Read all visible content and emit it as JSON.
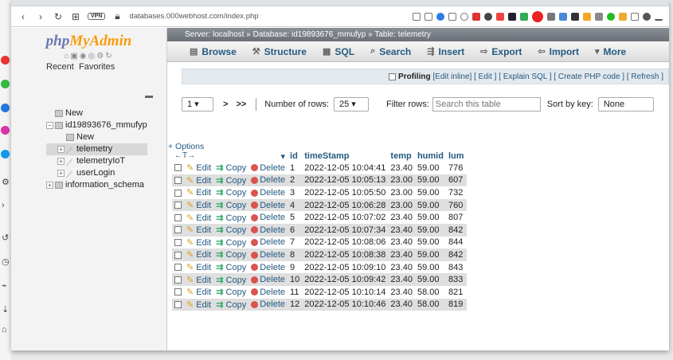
{
  "browser": {
    "url": "databases.000webhost.com/index.php",
    "vpn_label": "VPN"
  },
  "pma": {
    "logo_php": "php",
    "logo_myadmin": "MyAdmin",
    "recent": "Recent",
    "favorites": "Favorites",
    "tree": [
      {
        "label": "New",
        "level": 0,
        "expander": "",
        "icon": "db"
      },
      {
        "label": "id19893676_mmufyp",
        "level": 0,
        "expander": "−",
        "icon": "db"
      },
      {
        "label": "New",
        "level": 1,
        "expander": "",
        "icon": "db"
      },
      {
        "label": "telemetry",
        "level": 1,
        "expander": "+",
        "icon": "table",
        "selected": true
      },
      {
        "label": "telemetryIoT",
        "level": 1,
        "expander": "+",
        "icon": "table"
      },
      {
        "label": "userLogin",
        "level": 1,
        "expander": "+",
        "icon": "table"
      },
      {
        "label": "information_schema",
        "level": 0,
        "expander": "+",
        "icon": "db"
      }
    ]
  },
  "breadcrumb": {
    "server": "Server: localhost",
    "database": "Database: id19893676_mmufyp",
    "table": "Table: telemetry",
    "sep": "»"
  },
  "tabs": [
    {
      "label": "Browse",
      "icon": "▤"
    },
    {
      "label": "Structure",
      "icon": "⚒"
    },
    {
      "label": "SQL",
      "icon": "▦"
    },
    {
      "label": "Search",
      "icon": "⌕"
    },
    {
      "label": "Insert",
      "icon": "⇶"
    },
    {
      "label": "Export",
      "icon": "⇨"
    },
    {
      "label": "Import",
      "icon": "⇦"
    },
    {
      "label": "More",
      "icon": "▾"
    }
  ],
  "profiling": {
    "label": "Profiling",
    "links": [
      "[Edit inline]",
      "[ Edit ]",
      "[ Explain SQL ]",
      "[ Create PHP code ]",
      "[ Refresh ]"
    ]
  },
  "navigation": {
    "page": "1",
    "next": ">",
    "last": ">>",
    "rows_label": "Number of rows:",
    "rows_value": "25",
    "filter_label": "Filter rows:",
    "filter_placeholder": "Search this table",
    "sort_label": "Sort by key:",
    "sort_value": "None"
  },
  "options_label": "+ Options",
  "sort_arrows": "←T→",
  "columns": [
    "id",
    "timeStamp",
    "temp",
    "humid",
    "lum"
  ],
  "actions": {
    "edit": "Edit",
    "copy": "Copy",
    "delete": "Delete"
  },
  "rows": [
    {
      "id": "1",
      "timeStamp": "2022-12-05 10:04:41",
      "temp": "23.40",
      "humid": "59.00",
      "lum": "776"
    },
    {
      "id": "2",
      "timeStamp": "2022-12-05 10:05:13",
      "temp": "23.00",
      "humid": "59.00",
      "lum": "607"
    },
    {
      "id": "3",
      "timeStamp": "2022-12-05 10:05:50",
      "temp": "23.00",
      "humid": "59.00",
      "lum": "732"
    },
    {
      "id": "4",
      "timeStamp": "2022-12-05 10:06:28",
      "temp": "23.00",
      "humid": "59.00",
      "lum": "760"
    },
    {
      "id": "5",
      "timeStamp": "2022-12-05 10:07:02",
      "temp": "23.40",
      "humid": "59.00",
      "lum": "807"
    },
    {
      "id": "6",
      "timeStamp": "2022-12-05 10:07:34",
      "temp": "23.40",
      "humid": "59.00",
      "lum": "842"
    },
    {
      "id": "7",
      "timeStamp": "2022-12-05 10:08:06",
      "temp": "23.40",
      "humid": "59.00",
      "lum": "844"
    },
    {
      "id": "8",
      "timeStamp": "2022-12-05 10:08:38",
      "temp": "23.40",
      "humid": "59.00",
      "lum": "842"
    },
    {
      "id": "9",
      "timeStamp": "2022-12-05 10:09:10",
      "temp": "23.40",
      "humid": "59.00",
      "lum": "843"
    },
    {
      "id": "10",
      "timeStamp": "2022-12-05 10:09:42",
      "temp": "23.40",
      "humid": "59.00",
      "lum": "833"
    },
    {
      "id": "11",
      "timeStamp": "2022-12-05 10:10:14",
      "temp": "23.40",
      "humid": "58.00",
      "lum": "821"
    },
    {
      "id": "12",
      "timeStamp": "2022-12-05 10:10:46",
      "temp": "23.40",
      "humid": "58.00",
      "lum": "819"
    }
  ]
}
